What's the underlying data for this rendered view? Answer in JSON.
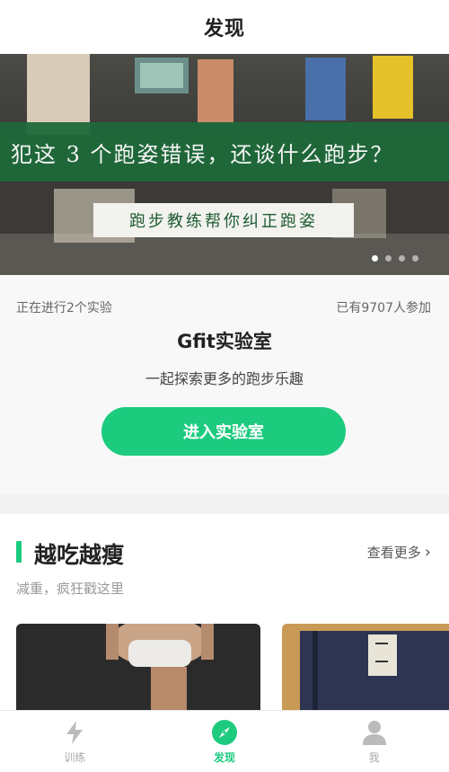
{
  "header": {
    "title": "发现"
  },
  "banner": {
    "headline": "犯这 3 个跑姿错误，还谈什么跑步？",
    "subline": "跑步教练帮你纠正跑姿",
    "dot_count": 4,
    "active_dot": 0
  },
  "lab": {
    "running_text": "正在进行2个实验",
    "participants_text": "已有9707人参加",
    "title": "Gfit实验室",
    "subtitle": "一起探索更多的跑步乐趣",
    "enter_label": "进入实验室"
  },
  "section": {
    "title": "越吃越瘦",
    "more_label": "查看更多",
    "description": "减重，疯狂戳这里"
  },
  "tabbar": {
    "items": [
      {
        "label": "训练",
        "icon": "lightning-icon",
        "active": false
      },
      {
        "label": "发现",
        "icon": "compass-icon",
        "active": true
      },
      {
        "label": "我",
        "icon": "person-icon",
        "active": false
      }
    ]
  },
  "colors": {
    "accent": "#1dcb7f",
    "banner_strip": "#1e6a3a"
  }
}
